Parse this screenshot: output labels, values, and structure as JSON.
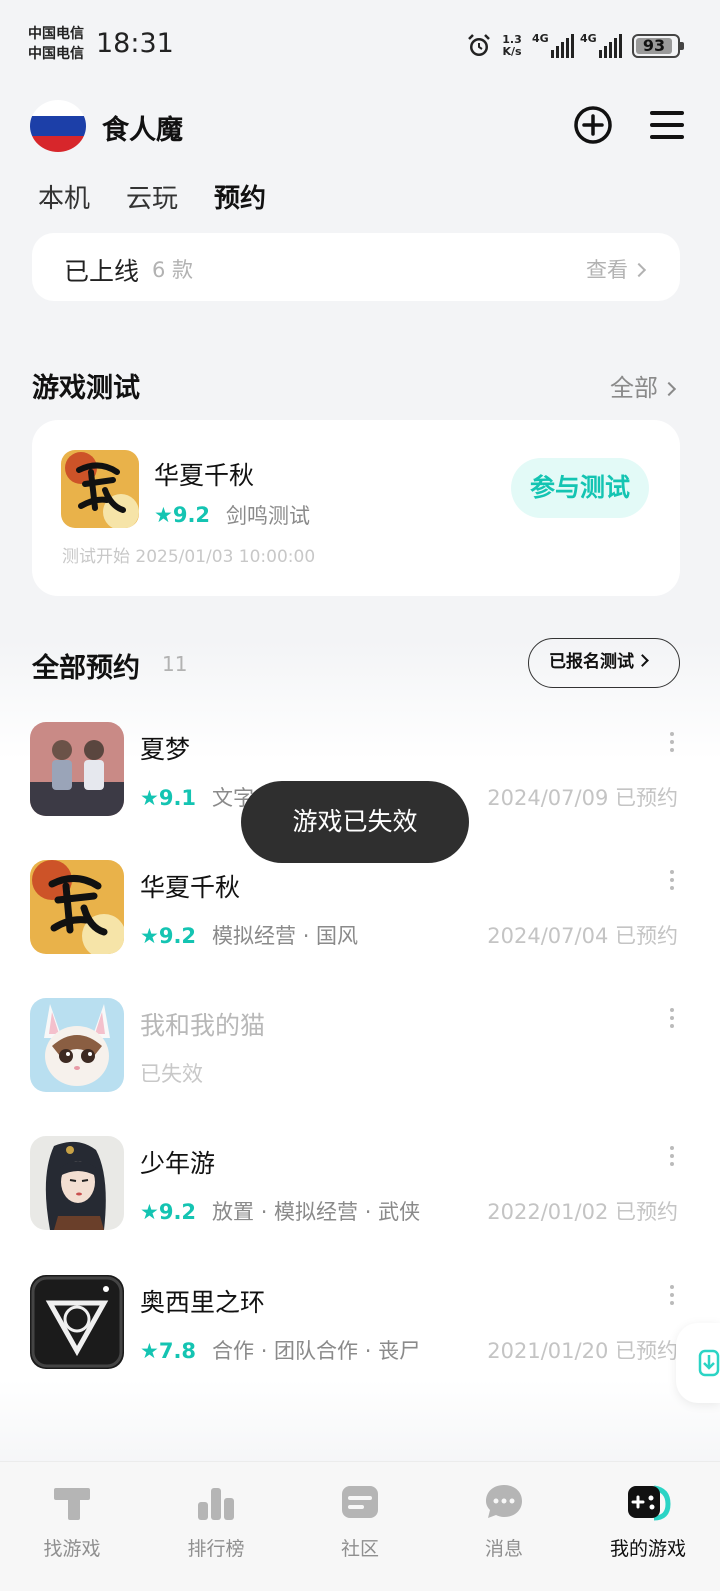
{
  "status_bar": {
    "carrier_1": "中国电信",
    "carrier_2": "中国电信",
    "time": "18:31",
    "speed_value": "1.3",
    "speed_unit": "K/s",
    "network_1": "4G",
    "network_2": "4G",
    "battery": "93"
  },
  "header": {
    "username": "食人魔",
    "add_icon": "plus-circle-icon",
    "menu_icon": "menu-icon"
  },
  "tabs": [
    {
      "label": "本机",
      "active": false
    },
    {
      "label": "云玩",
      "active": false
    },
    {
      "label": "预约",
      "active": true
    }
  ],
  "online": {
    "title": "已上线",
    "count": "6 款",
    "view_label": "查看"
  },
  "test_section": {
    "title": "游戏测试",
    "all_label": "全部",
    "card": {
      "name": "华夏千秋",
      "rating": "9.2",
      "test_type": "剑鸣测试",
      "start_time": "测试开始 2025/01/03 10:00:00",
      "button_label": "参与测试"
    }
  },
  "reservations": {
    "title": "全部预约",
    "count": "11",
    "registered_label": "已报名测试",
    "games": [
      {
        "name": "夏梦",
        "rating": "9.1",
        "tags": "文字",
        "date": "2024/07/09 已预约"
      },
      {
        "name": "华夏千秋",
        "rating": "9.2",
        "tags": "模拟经营 · 国风",
        "date": "2024/07/04 已预约"
      },
      {
        "name": "我和我的猫",
        "status": "已失效"
      },
      {
        "name": "少年游",
        "rating": "9.2",
        "tags": "放置 · 模拟经营 · 武侠",
        "date": "2022/01/02 已预约"
      },
      {
        "name": "奥西里之环",
        "rating": "7.8",
        "tags": "合作 · 团队合作 · 丧尸",
        "date": "2021/01/20 已预约"
      }
    ]
  },
  "toast": "游戏已失效",
  "bottom_nav": [
    {
      "label": "找游戏",
      "icon": "find-game-icon"
    },
    {
      "label": "排行榜",
      "icon": "leaderboard-icon"
    },
    {
      "label": "社区",
      "icon": "community-icon"
    },
    {
      "label": "消息",
      "icon": "message-icon"
    },
    {
      "label": "我的游戏",
      "icon": "gamepad-icon",
      "active": true
    }
  ],
  "colors": {
    "accent": "#14c4b2",
    "tab_highlight": "#2bd4c5",
    "toast_bg": "#2f2f2f"
  }
}
